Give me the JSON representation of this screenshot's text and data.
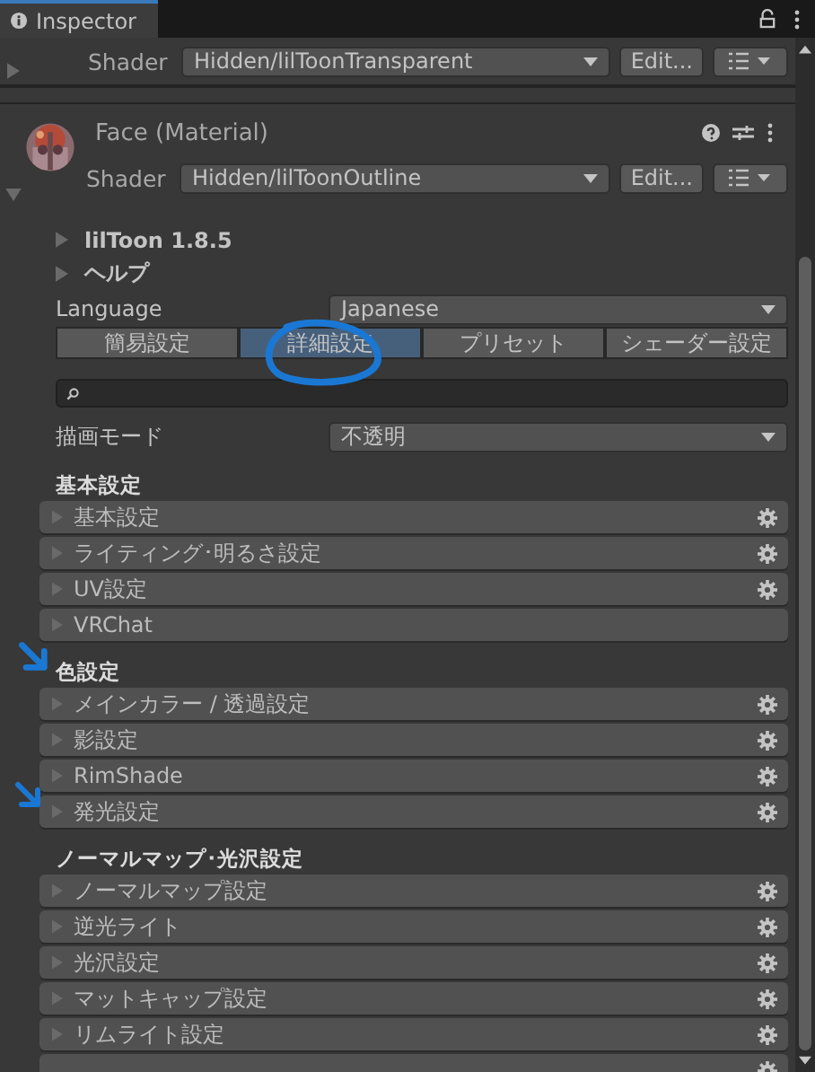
{
  "window": {
    "title": "Inspector"
  },
  "previous_component": {
    "shader_label": "Shader",
    "shader": "Hidden/lilToonTransparent",
    "edit_button": "Edit..."
  },
  "material": {
    "title": "Face (Material)",
    "shader_label": "Shader",
    "shader": "Hidden/lilToonOutline",
    "edit_button": "Edit..."
  },
  "foldouts": [
    {
      "label": "lilToon 1.8.5"
    },
    {
      "label": "ヘルプ"
    }
  ],
  "language": {
    "label": "Language",
    "value": "Japanese"
  },
  "tabs": [
    {
      "label": "簡易設定",
      "selected": false
    },
    {
      "label": "詳細設定",
      "selected": true,
      "circled": true
    },
    {
      "label": "プリセット",
      "selected": false
    },
    {
      "label": "シェーダー設定",
      "selected": false
    }
  ],
  "render_mode": {
    "label": "描画モード",
    "value": "不透明"
  },
  "sections": [
    {
      "title": "基本設定",
      "items": [
        {
          "label": "基本設定",
          "settings": true
        },
        {
          "label": "ライティング･明るさ設定",
          "settings": true
        },
        {
          "label": "UV設定",
          "settings": true
        },
        {
          "label": "VRChat",
          "settings": false
        }
      ]
    },
    {
      "title": "色設定",
      "annotated": true,
      "items": [
        {
          "label": "メインカラー / 透過設定",
          "settings": true
        },
        {
          "label": "影設定",
          "settings": true
        },
        {
          "label": "RimShade",
          "settings": true
        },
        {
          "label": "発光設定",
          "settings": true,
          "annotated": true
        }
      ]
    },
    {
      "title": "ノーマルマップ･光沢設定",
      "items": [
        {
          "label": "ノーマルマップ設定",
          "settings": true
        },
        {
          "label": "逆光ライト",
          "settings": true
        },
        {
          "label": "光沢設定",
          "settings": true
        },
        {
          "label": "マットキャップ設定",
          "settings": true
        },
        {
          "label": "リムライト設定",
          "settings": true
        },
        {
          "kind": "cut",
          "settings": true
        }
      ]
    }
  ]
}
